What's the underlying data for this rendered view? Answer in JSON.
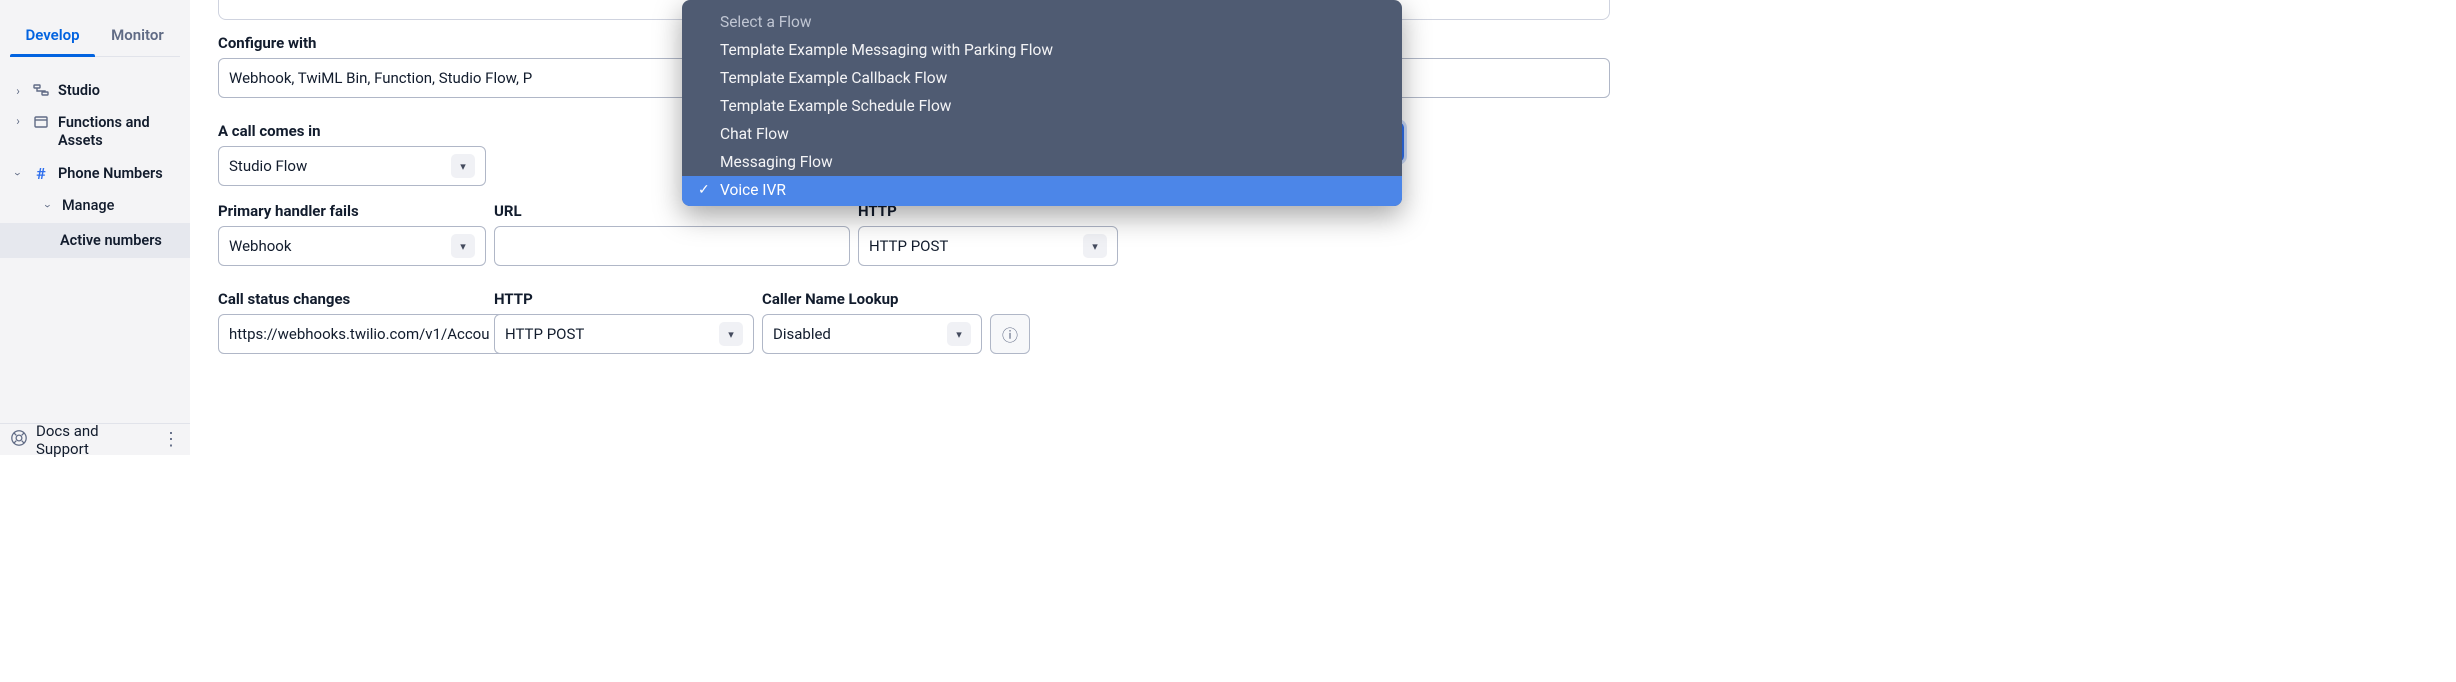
{
  "sidebar": {
    "tabs": {
      "develop": "Develop",
      "monitor": "Monitor"
    },
    "items": {
      "studio": "Studio",
      "functions": "Functions and Assets",
      "phone_numbers": "Phone Numbers",
      "manage": "Manage",
      "active_numbers": "Active numbers"
    },
    "docs": "Docs and Support"
  },
  "form": {
    "configure_with": {
      "label": "Configure with",
      "value": "Webhook, TwiML Bin, Function, Studio Flow, P"
    },
    "call_comes_in": {
      "label": "A call comes in",
      "value": "Studio Flow"
    },
    "primary_fails": {
      "label": "Primary handler fails",
      "value": "Webhook"
    },
    "url": {
      "label": "URL",
      "value": ""
    },
    "http1": {
      "label": "HTTP",
      "value": "HTTP POST"
    },
    "call_status_changes": {
      "label": "Call status changes",
      "value": "https://webhooks.twilio.com/v1/Accou"
    },
    "http2": {
      "label": "HTTP",
      "value": "HTTP POST"
    },
    "caller_name_lookup": {
      "label": "Caller Name Lookup",
      "value": "Disabled"
    }
  },
  "flow_dropdown": {
    "placeholder": "Select a Flow",
    "options": [
      "Template Example Messaging with Parking Flow",
      "Template Example Callback Flow",
      "Template Example Schedule Flow",
      "Chat Flow",
      "Messaging Flow"
    ],
    "selected": "Voice IVR"
  }
}
